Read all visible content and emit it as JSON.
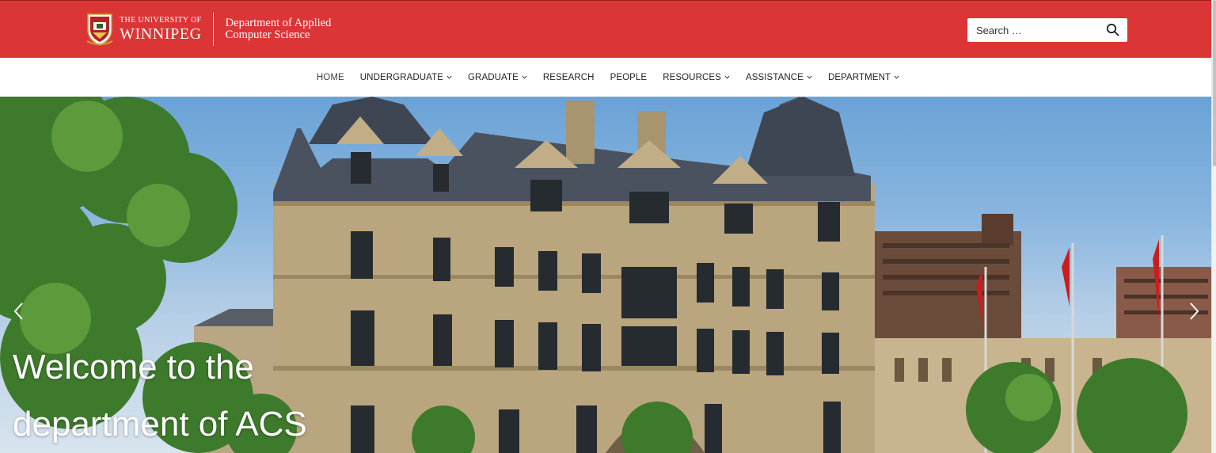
{
  "header": {
    "university_small": "THE UNIVERSITY OF",
    "university_big": "WINNIPEG",
    "department_line1": "Department of Applied",
    "department_line2": "Computer Science",
    "brand_color": "#dc3535"
  },
  "search": {
    "placeholder": "Search …",
    "icon": "search-icon"
  },
  "nav": {
    "items": [
      {
        "label": "HOME",
        "dropdown": false
      },
      {
        "label": "UNDERGRADUATE",
        "dropdown": true
      },
      {
        "label": "GRADUATE",
        "dropdown": true
      },
      {
        "label": "RESEARCH",
        "dropdown": false
      },
      {
        "label": "PEOPLE",
        "dropdown": false
      },
      {
        "label": "RESOURCES",
        "dropdown": true
      },
      {
        "label": "ASSISTANCE",
        "dropdown": true
      },
      {
        "label": "DEPARTMENT",
        "dropdown": true
      }
    ]
  },
  "hero": {
    "line1": "Welcome to the",
    "line2": "department of ACS",
    "prev_icon": "chevron-left-icon",
    "next_icon": "chevron-right-icon"
  }
}
